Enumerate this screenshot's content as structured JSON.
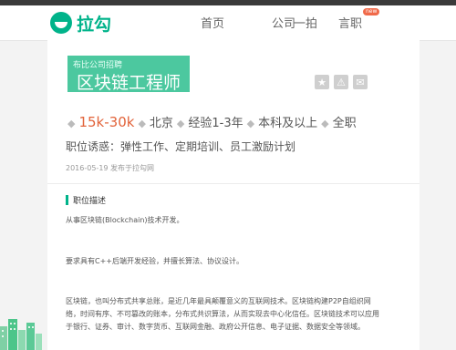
{
  "logo": {
    "text": "拉勾"
  },
  "nav": {
    "items": [
      "首页",
      "公司",
      "一拍",
      "言职"
    ],
    "badge": "new"
  },
  "job": {
    "company_line": "布比公司招聘",
    "title": "区块链工程师",
    "salary": "15k-30k",
    "city": "北京",
    "experience": "经验1-3年",
    "education": "本科及以上",
    "type": "全职",
    "temptation": "职位诱惑：弹性工作、定期培训、员工激励计划",
    "date": "2016-05-19  发布于拉勾网"
  },
  "description": {
    "heading": "职位描述",
    "para1": "从事区块链(Blockchain)技术开发。",
    "para2": "要求具有C++后端开发经验，并擅长算法、协议设计。",
    "para3": "区块链，也叫分布式共享总账，是近几年最具颠覆意义的互联网技术。区块链构建P2P自组织网络，时间有序、不可篡改的账本，分布式共识算法，从而实现去中心化信任。区块链技术可以应用于银行、证券、审计、数字货币、互联网金融、政府公开信息、电子证据、数据安全等领域。"
  },
  "icons": [
    "star-icon",
    "warning-icon",
    "chat-icon"
  ],
  "colors": {
    "brand": "#00b38a",
    "title_bg": "#4cc89f",
    "salary": "#e2633a",
    "badge": "#f06a4a"
  }
}
